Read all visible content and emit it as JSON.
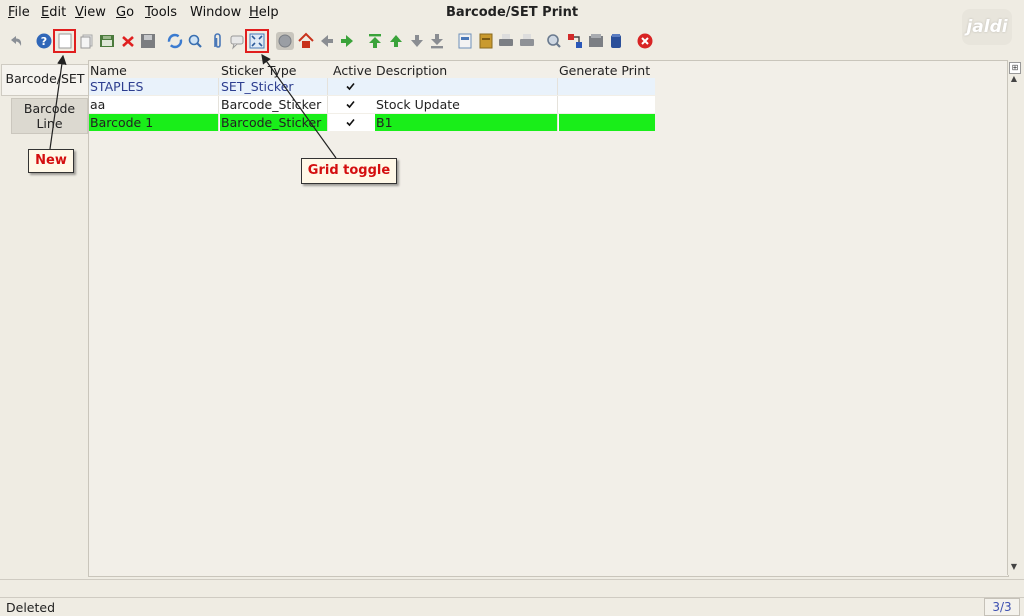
{
  "window": {
    "title": "Barcode/SET Print",
    "logo_text": "jaldi"
  },
  "menu": [
    {
      "label": "File",
      "u": "F",
      "rest": "ile"
    },
    {
      "label": "Edit",
      "u": "E",
      "rest": "dit"
    },
    {
      "label": "View",
      "u": "V",
      "rest": "iew"
    },
    {
      "label": "Go",
      "u": "G",
      "rest": "o"
    },
    {
      "label": "Tools",
      "u": "T",
      "rest": "ools"
    },
    {
      "label": "Window",
      "u": "",
      "rest": "Window"
    },
    {
      "label": "Help",
      "u": "H",
      "rest": "elp"
    }
  ],
  "toolbar_icons": [
    "undo-icon",
    "help-icon",
    "new-record-icon",
    "copy-record-icon",
    "save-icon",
    "delete-icon",
    "save-disk-icon",
    "refresh-icon",
    "find-icon",
    "attachment-icon",
    "chat-icon",
    "grid-toggle-icon",
    "history-icon",
    "home-icon",
    "back-icon",
    "forward-icon",
    "first-record-icon",
    "previous-record-icon",
    "next-record-icon",
    "last-record-icon",
    "report-icon",
    "archive-icon",
    "print-preview-icon",
    "print-icon",
    "zoom-across-icon",
    "workflow-icon",
    "request-icon",
    "product-info-icon",
    "exit-icon"
  ],
  "tabs": {
    "active": "Barcode/SET",
    "second_line1": "Barcode",
    "second_line2": "Line"
  },
  "grid": {
    "columns": [
      "Name",
      "Sticker Type",
      "Active",
      "Description",
      "Generate Print"
    ],
    "rows": [
      {
        "name": "STAPLES",
        "sticker_type": "SET_Sticker",
        "active": true,
        "description": "",
        "generate_print": ""
      },
      {
        "name": "aa",
        "sticker_type": "Barcode_Sticker",
        "active": true,
        "description": "Stock Update",
        "generate_print": ""
      },
      {
        "name": "Barcode 1",
        "sticker_type": "Barcode_Sticker",
        "active": true,
        "description": "B1",
        "generate_print": ""
      }
    ]
  },
  "colors": {
    "selected_row": "#19ee19",
    "first_row": "#e9f2fb",
    "callout_text": "#d40f0f",
    "highlight_box": "#e01e1e"
  },
  "status": {
    "message": "Deleted",
    "record_count": "3/3"
  },
  "callouts": {
    "new_label": "New",
    "grid_toggle_label": "Grid toggle"
  }
}
